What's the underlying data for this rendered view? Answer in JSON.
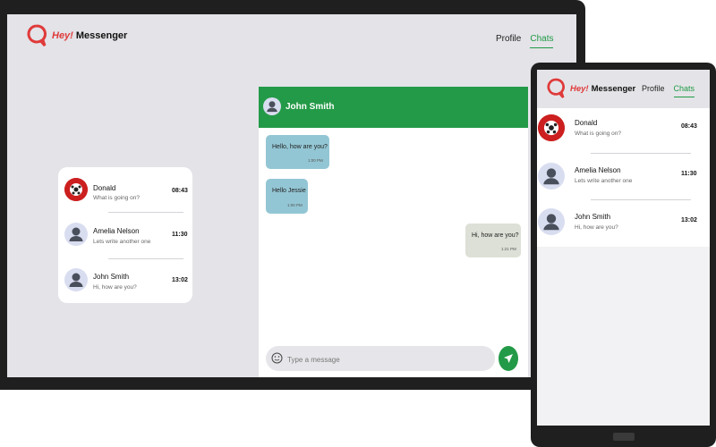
{
  "brand": {
    "hey": "Hey!",
    "name": "Messenger"
  },
  "nav": {
    "profile": "Profile",
    "chats": "Chats"
  },
  "chats": [
    {
      "name": "Donald",
      "preview": "What is going on?",
      "time": "08:43",
      "avatar": "soccer-ball"
    },
    {
      "name": "Amelia Nelson",
      "preview": "Lets write another one",
      "time": "11:30",
      "avatar": "person"
    },
    {
      "name": "John Smith",
      "preview": "Hi, how are you?",
      "time": "13:02",
      "avatar": "person"
    }
  ],
  "conversation": {
    "contact": "John Smith",
    "messages": [
      {
        "text": "Hello, how are you?",
        "time": "1:00 PM",
        "direction": "in"
      },
      {
        "text": "Hello Jessie",
        "time": "1:00 PM",
        "direction": "in"
      },
      {
        "text": "Hi, how are you?",
        "time": "1:21 PM",
        "direction": "out"
      }
    ],
    "composer_placeholder": "Type a message"
  },
  "colors": {
    "accent": "#239a47",
    "brand_red": "#e03a3a",
    "incoming_bubble": "#93c6d4",
    "outgoing_bubble": "#dde0d6"
  }
}
